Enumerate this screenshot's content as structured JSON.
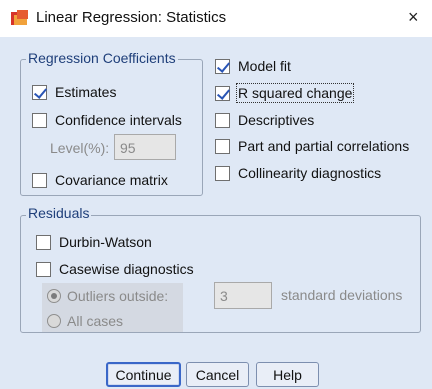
{
  "window": {
    "title": "Linear Regression: Statistics",
    "close_glyph": "×",
    "icon": "spss-regression-icon"
  },
  "regression_coefficients": {
    "legend": "Regression Coefficients",
    "estimates": {
      "label": "Estimates",
      "checked": true
    },
    "confidence_intervals": {
      "label": "Confidence intervals",
      "checked": false
    },
    "level_label": "Level(%):",
    "level_value": "95",
    "covariance_matrix": {
      "label": "Covariance matrix",
      "checked": false
    }
  },
  "options": {
    "model_fit": {
      "label": "Model fit",
      "checked": true
    },
    "r_squared_change": {
      "label": "R squared change",
      "checked": true
    },
    "descriptives": {
      "label": "Descriptives",
      "checked": false
    },
    "part_partial": {
      "label": "Part and partial correlations",
      "checked": false
    },
    "collinearity": {
      "label": "Collinearity diagnostics",
      "checked": false
    }
  },
  "residuals": {
    "legend": "Residuals",
    "durbin_watson": {
      "label": "Durbin-Watson",
      "checked": false
    },
    "casewise": {
      "label": "Casewise diagnostics",
      "checked": false
    },
    "outliers_outside": {
      "label": "Outliers outside:",
      "selected": true
    },
    "outliers_value": "3",
    "std_dev_label": "standard deviations",
    "all_cases": {
      "label": "All cases",
      "selected": false
    }
  },
  "buttons": {
    "continue": "Continue",
    "cancel": "Cancel",
    "help": "Help"
  },
  "colors": {
    "dialog_bg": "#dfe8f5",
    "accent": "#3a67c8",
    "legend_text": "#1f3f7a"
  }
}
